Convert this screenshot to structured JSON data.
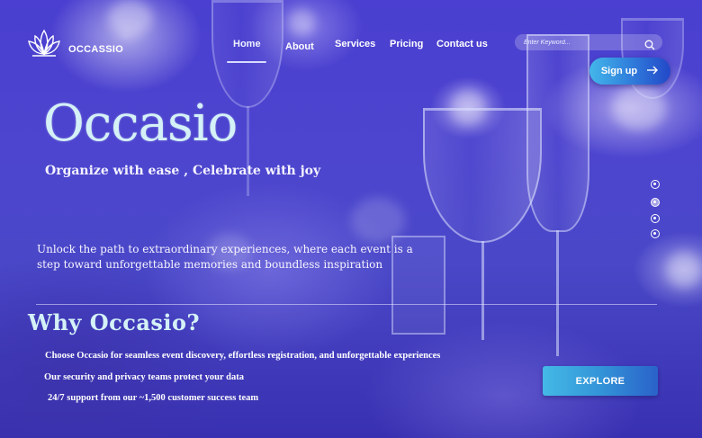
{
  "brand": {
    "logo_icon": "lotus-icon",
    "name": "OCCASSIO"
  },
  "nav": {
    "items": [
      {
        "label": "Home",
        "active": true
      },
      {
        "label": "About",
        "active": false
      },
      {
        "label": "Services",
        "active": false
      },
      {
        "label": "Pricing",
        "active": false
      },
      {
        "label": "Contact us",
        "active": false
      }
    ]
  },
  "search": {
    "placeholder": "Enter Keyword...",
    "value": "",
    "icon": "search-icon"
  },
  "signup": {
    "label": "Sign up",
    "icon": "arrow-right-icon"
  },
  "hero": {
    "title": "Occasio",
    "subtitle": "Organize with ease , Celebrate with joy",
    "description": "Unlock the path to extraordinary experiences, where each event is a step toward unforgettable memories and boundless inspiration"
  },
  "carousel": {
    "slide_count": 4,
    "active_index": 1
  },
  "why": {
    "title": "Why Occasio?",
    "bullets": [
      "Choose Occasio for seamless event discovery, effortless registration, and unforgettable experiences",
      "Our security and privacy teams protect your data",
      "24/7 support from our ~1,500 customer success team"
    ],
    "cta_label": "EXPLORE"
  },
  "colors": {
    "accent_cyan": "#44b9e6",
    "accent_blue": "#2a62c9",
    "title_tint": "#d4f1f7",
    "background": "#4a42cc"
  }
}
